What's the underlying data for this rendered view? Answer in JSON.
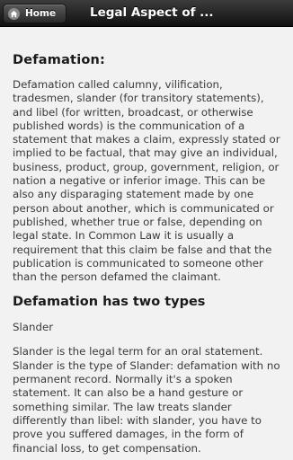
{
  "header": {
    "home_label": "Home",
    "home_icon": "home-icon",
    "title": "Legal Aspect of ..."
  },
  "article": {
    "heading1": "Defamation:",
    "paragraph1": "Defamation called calumny, vilification, tradesmen, slander (for transitory statements), and libel (for written, broadcast, or otherwise published words) is the communication of a statement that makes a claim, expressly stated or implied to be factual, that may give an individual, business, product, group, government, religion, or nation a negative or inferior image. This can be also any disparaging statement made by one person about another, which is communicated or published, whether true or false, depending on legal state. In Common Law it is usually a requirement that this claim be false and that the publication is communicated to someone other than the person defamed the claimant.",
    "heading2": "Defamation has two types",
    "subheading": "Slander",
    "paragraph2": "Slander is the legal term for an oral statement. Slander is the type of Slander: defamation with no permanent record. Normally it's a spoken statement. It can also be a hand gesture or something similar. The law treats slander differently than libel: with slander, you have to prove you suffered damages, in the form of financial loss, to get compensation."
  }
}
